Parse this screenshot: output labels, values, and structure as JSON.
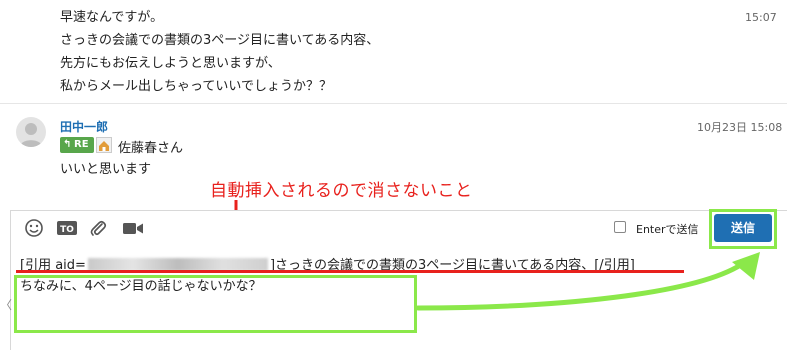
{
  "message1": {
    "lines": [
      "早速なんですが。",
      "さっきの会議での書類の3ページ目に書いてある内容、",
      "先方にもお伝えしようと思いますが、",
      "私からメール出しちゃっていいでしょうか？？"
    ],
    "time": "15:07"
  },
  "message2": {
    "author": "田中一郎",
    "time": "10月23日 15:08",
    "re_label": "RE",
    "reply_to": "佐藤春さん",
    "body": "いいと思います"
  },
  "annotation": {
    "text": "自動挿入されるので消さないこと",
    "color": "#e8211d",
    "highlight_color": "#8be84a"
  },
  "toolbar": {
    "icons": [
      "emoji-icon",
      "to-icon",
      "attachment-icon",
      "video-icon"
    ],
    "to_label": "TO",
    "enter_label": "Enterで送信",
    "send_label": "送信"
  },
  "composer": {
    "quote_prefix": "[引用 aid=",
    "quote_suffix": "]さっきの会議での書類の3ページ目に書いてある内容、[/引用]",
    "typed_text": "ちなみに、4ページ目の話じゃないかな？"
  },
  "colors": {
    "accent": "#1f6fb3",
    "re_badge": "#58a64b"
  }
}
